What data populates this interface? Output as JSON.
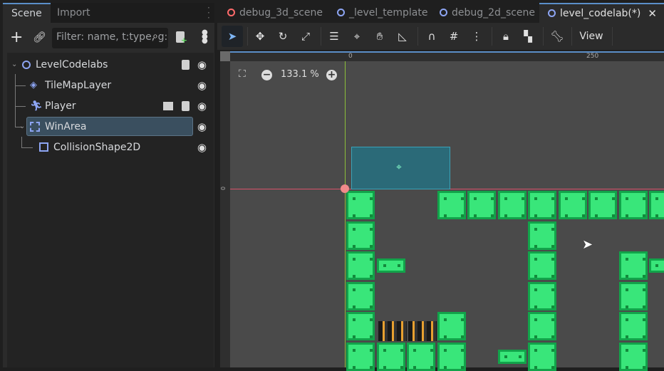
{
  "scene_dock": {
    "tabs": [
      "Scene",
      "Import"
    ],
    "filter_placeholder": "Filter: name, t:type, g:group",
    "tree": [
      {
        "label": "LevelCodelabs"
      },
      {
        "label": "TileMapLayer"
      },
      {
        "label": "Player"
      },
      {
        "label": "WinArea",
        "selected": true
      },
      {
        "label": "CollisionShape2D"
      }
    ]
  },
  "editor": {
    "tabs": [
      {
        "label": "debug_3d_scene",
        "color": "#ff6b6b"
      },
      {
        "label": "_level_template",
        "color": "#8da5f3"
      },
      {
        "label": "debug_2d_scene",
        "color": "#8da5f3"
      },
      {
        "label": "level_codelab(*)",
        "color": "#8da5f3",
        "active": true
      }
    ],
    "view_menu": "View",
    "zoom_level": "133.1 %",
    "ruler_labels": {
      "top": [
        "0",
        "250"
      ],
      "left": [
        "0"
      ]
    }
  },
  "colors": {
    "accent": "#5b8fc9",
    "tile": "#39e67a",
    "win_area": "#2b6a78"
  }
}
